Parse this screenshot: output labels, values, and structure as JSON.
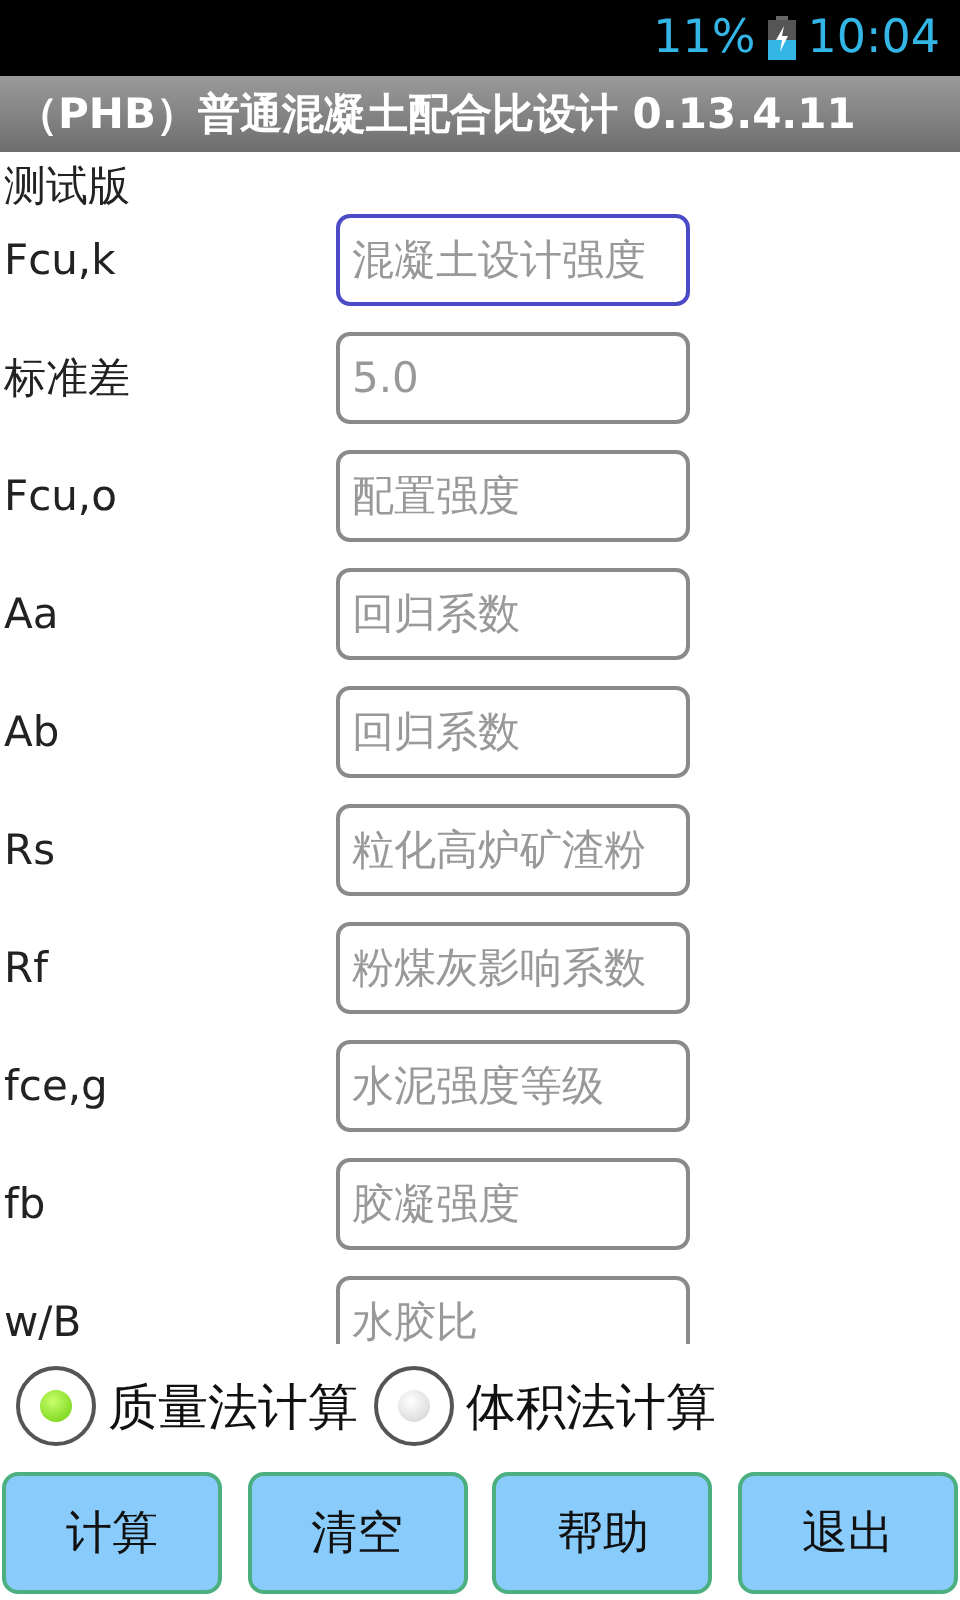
{
  "status_bar": {
    "battery": "11%",
    "time": "10:04"
  },
  "title_bar": {
    "title": "（PHB）普通混凝土配合比设计 0.13.4.11"
  },
  "subtitle": "测试版",
  "fields": [
    {
      "label": "Fcu,k",
      "placeholder": "混凝土设计强度",
      "focused": true
    },
    {
      "label": "标准差",
      "placeholder": "5.0",
      "focused": false
    },
    {
      "label": "Fcu,o",
      "placeholder": "配置强度",
      "focused": false
    },
    {
      "label": "Aa",
      "placeholder": "回归系数",
      "focused": false
    },
    {
      "label": "Ab",
      "placeholder": "回归系数",
      "focused": false
    },
    {
      "label": "Rs",
      "placeholder": "粒化高炉矿渣粉",
      "focused": false
    },
    {
      "label": "Rf",
      "placeholder": "粉煤灰影响系数",
      "focused": false
    },
    {
      "label": "fce,g",
      "placeholder": "水泥强度等级",
      "focused": false
    },
    {
      "label": "fb",
      "placeholder": "胶凝强度",
      "focused": false
    },
    {
      "label": "w/B",
      "placeholder": "水胶比",
      "focused": false
    }
  ],
  "methods": [
    {
      "label": "质量法计算",
      "selected": true
    },
    {
      "label": "体积法计算",
      "selected": false
    }
  ],
  "buttons": [
    "计算",
    "清空",
    "帮助",
    "退出"
  ]
}
